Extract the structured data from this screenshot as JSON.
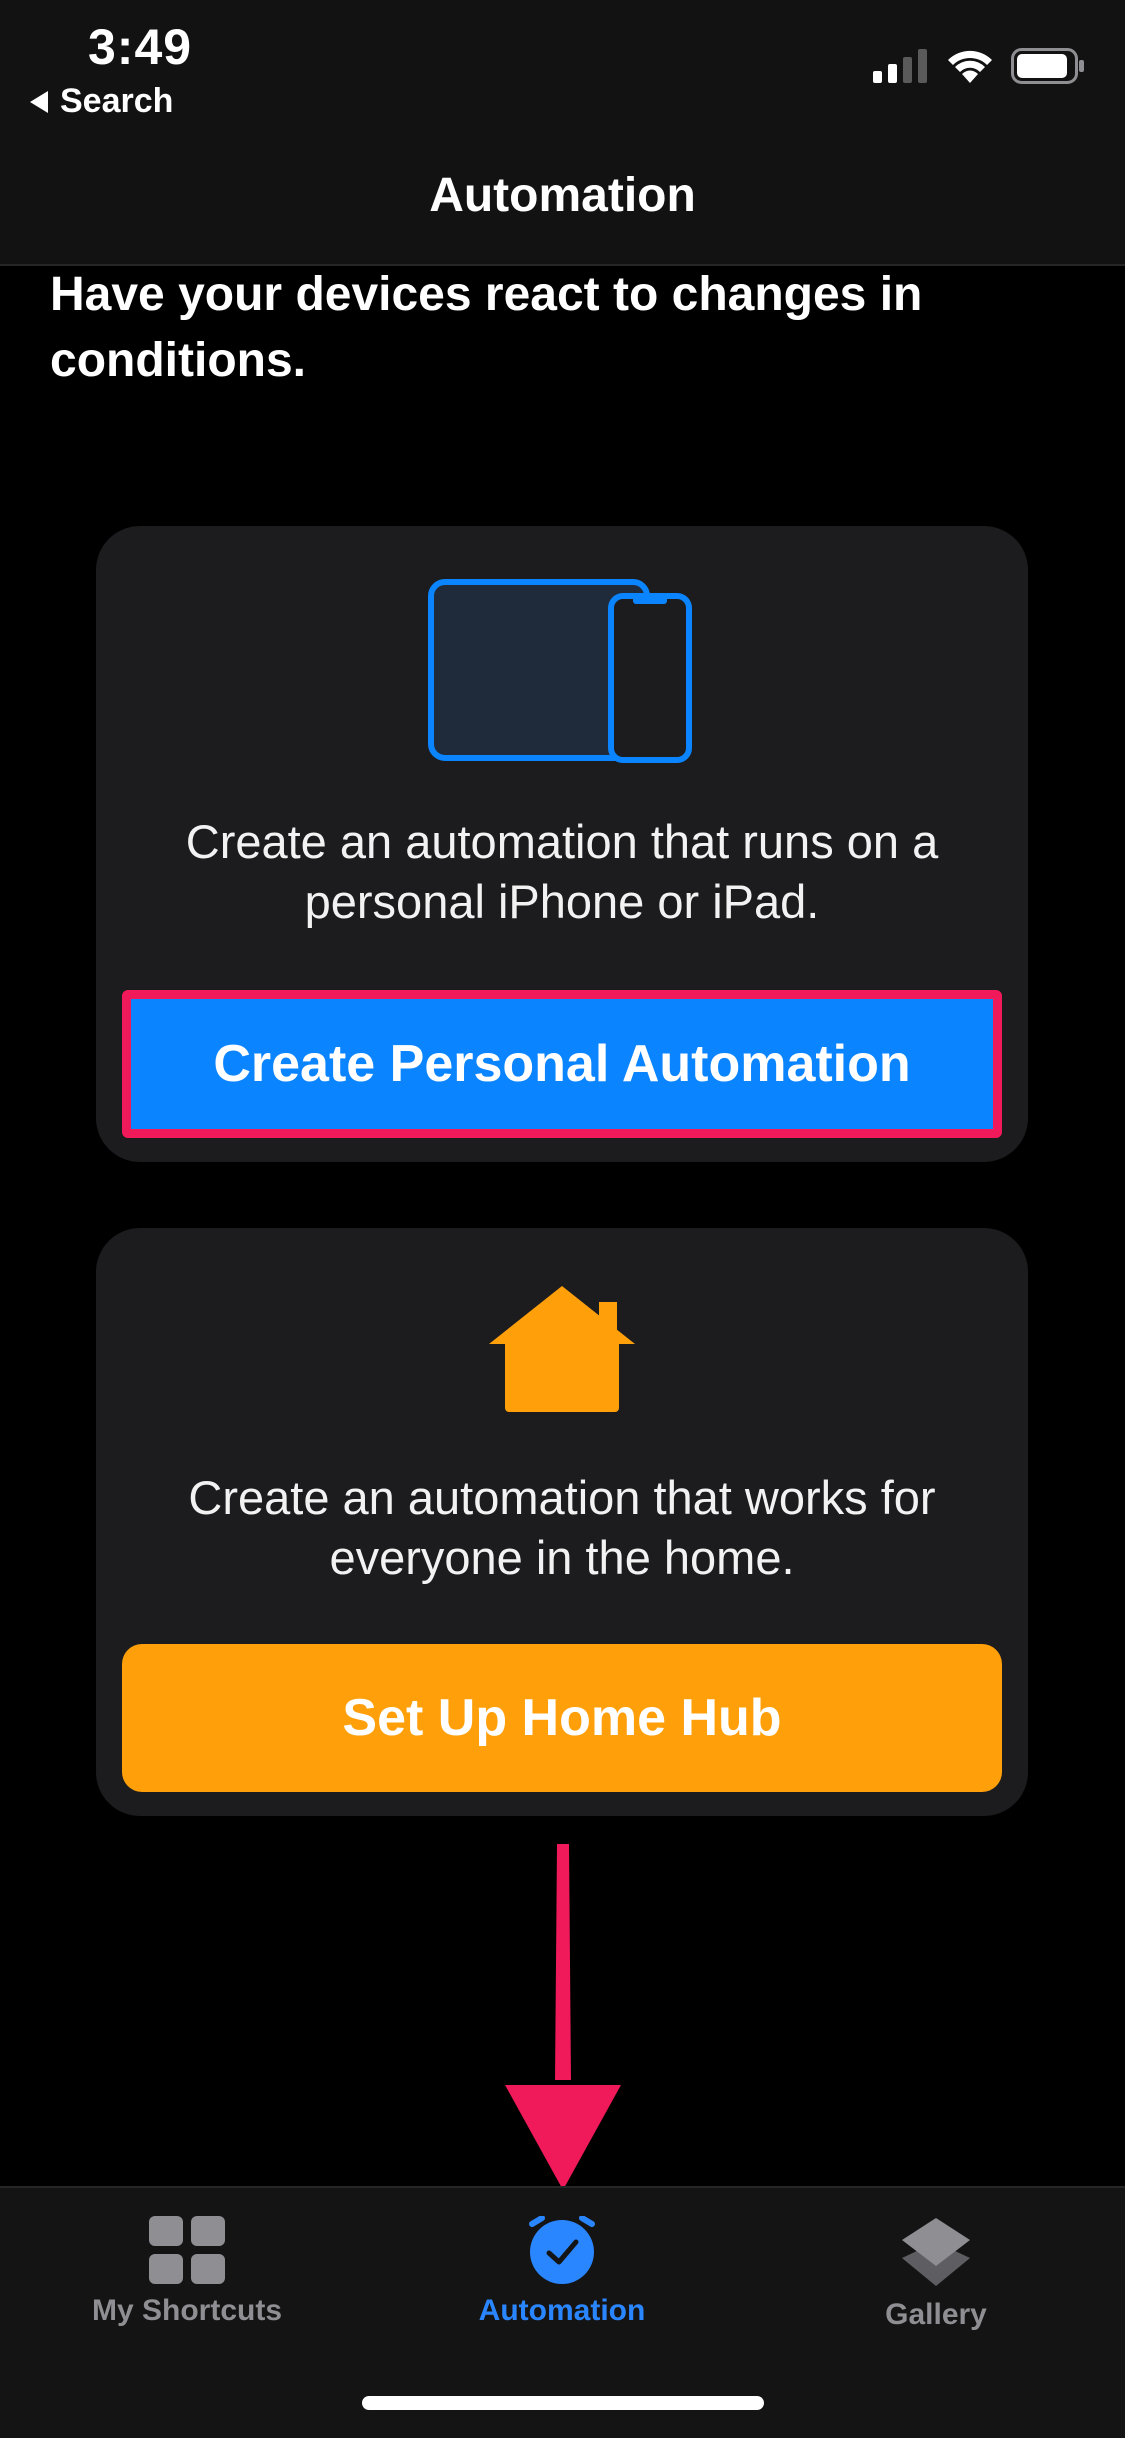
{
  "status_bar": {
    "time": "3:49",
    "back_label": "Search"
  },
  "header": {
    "title": "Automation"
  },
  "subtitle": "Have your devices react to changes in conditions.",
  "personal_card": {
    "description": "Create an automation that runs on a personal iPhone or iPad.",
    "button_label": "Create Personal Automation",
    "icon": "devices-icon"
  },
  "home_card": {
    "description": "Create an automation that works for everyone in the home.",
    "button_label": "Set Up Home Hub",
    "icon": "house-icon"
  },
  "tab_bar": {
    "tabs": [
      {
        "label": "My Shortcuts",
        "icon": "grid-icon",
        "active": false
      },
      {
        "label": "Automation",
        "icon": "clock-check-icon",
        "active": true
      },
      {
        "label": "Gallery",
        "icon": "layers-icon",
        "active": false
      }
    ]
  },
  "colors": {
    "accent_blue": "#0a84ff",
    "accent_orange": "#ff9f0a",
    "highlight_pink": "#f0195a",
    "card_bg": "#1c1c1e"
  }
}
